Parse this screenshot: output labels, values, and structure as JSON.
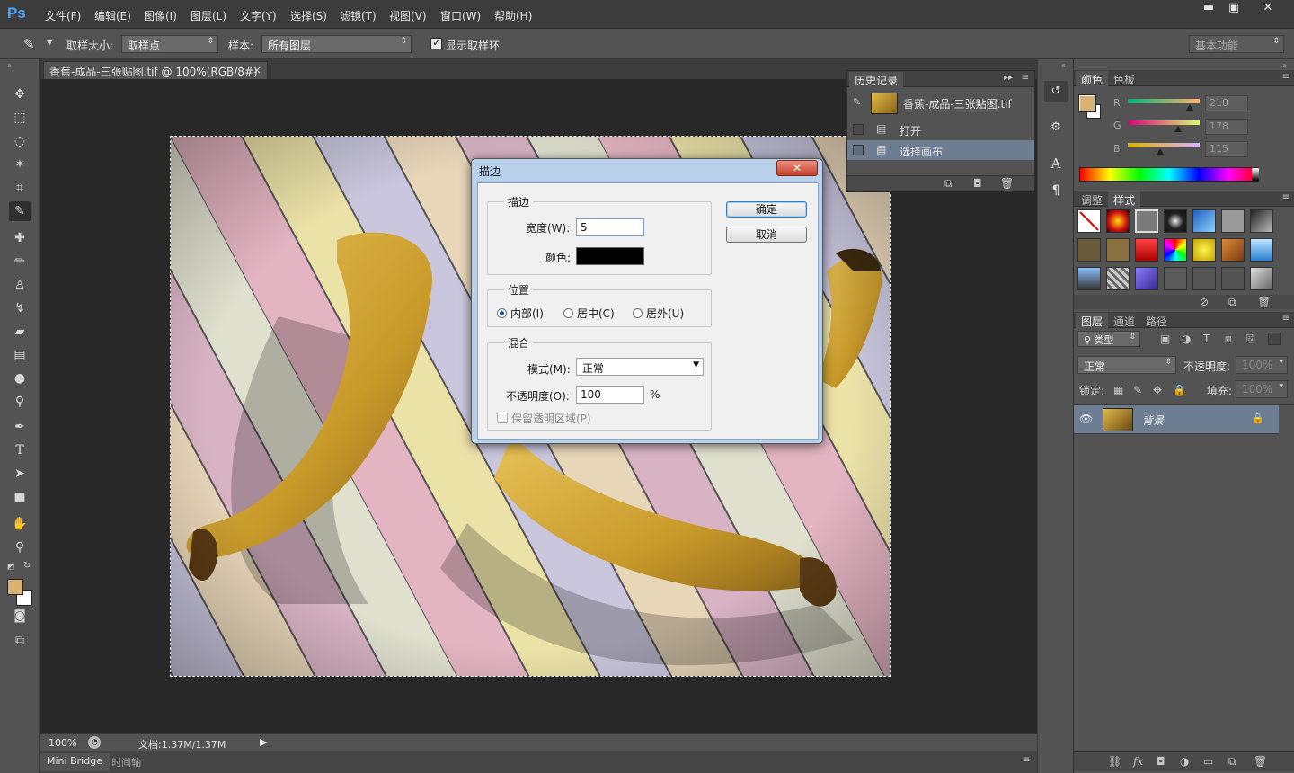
{
  "app": {
    "logo": "Ps"
  },
  "menu": [
    "文件(F)",
    "编辑(E)",
    "图像(I)",
    "图层(L)",
    "文字(Y)",
    "选择(S)",
    "滤镜(T)",
    "视图(V)",
    "窗口(W)",
    "帮助(H)"
  ],
  "window_controls": {
    "minimize": "▬",
    "maximize": "▣",
    "close": "✕"
  },
  "options": {
    "sample_size_label": "取样大小:",
    "sample_size_value": "取样点",
    "sample_label": "样本:",
    "sample_value": "所有图层",
    "show_ring_label": "显示取样环",
    "show_ring_checked": true,
    "workspace": "基本功能"
  },
  "document": {
    "tab_title": "香蕉-成品-三张贴图.tif @ 100%(RGB/8#)",
    "tab_close": "×"
  },
  "status": {
    "zoom": "100%",
    "doc_info": "文档:1.37M/1.37M"
  },
  "bottom_tabs": [
    "Mini Bridge",
    "时间轴"
  ],
  "history": {
    "title": "历史记录",
    "snapshot": "香蕉-成品-三张贴图.tif",
    "items": [
      "打开",
      "选择画布"
    ]
  },
  "color_panel": {
    "tabs": [
      "颜色",
      "色板"
    ],
    "channels": [
      {
        "label": "R",
        "value": "218"
      },
      {
        "label": "G",
        "value": "178"
      },
      {
        "label": "B",
        "value": "115"
      }
    ],
    "foreground": "#dab273"
  },
  "styles_panel": {
    "tabs": [
      "调整",
      "样式"
    ]
  },
  "layers_panel": {
    "tabs": [
      "图层",
      "通道",
      "路径"
    ],
    "filter": "类型",
    "blend_mode": "正常",
    "opacity_label": "不透明度:",
    "opacity_value": "100%",
    "lock_label": "锁定:",
    "fill_label": "填充:",
    "fill_value": "100%",
    "layer_name": "背景"
  },
  "dialog": {
    "title": "描边",
    "stroke_group": "描边",
    "width_label": "宽度(W):",
    "width_value": "5",
    "color_label": "颜色:",
    "position_group": "位置",
    "position_options": [
      "内部(I)",
      "居中(C)",
      "居外(U)"
    ],
    "blend_group": "混合",
    "mode_label": "模式(M):",
    "mode_value": "正常",
    "opacity_label": "不透明度(O):",
    "opacity_value": "100",
    "percent": "%",
    "preserve_label": "保留透明区域(P)",
    "ok": "确定",
    "cancel": "取消",
    "close": "✕"
  }
}
